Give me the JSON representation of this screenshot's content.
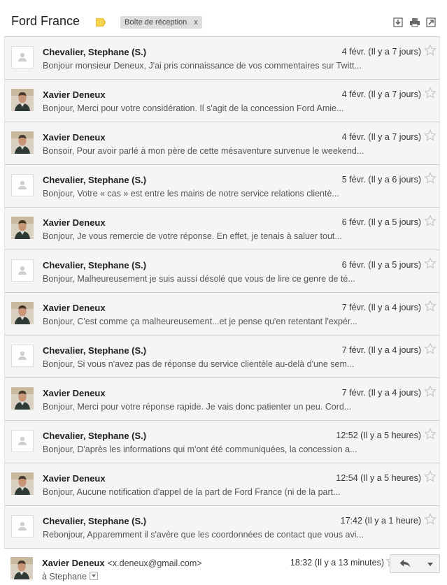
{
  "header": {
    "subject": "Ford France",
    "label": "Boîte de réception",
    "label_remove": "x",
    "icons": [
      "download-icon",
      "print-icon",
      "new-window-icon"
    ],
    "label_color": "#f7d24b"
  },
  "messages": [
    {
      "sender": "Chevalier, Stephane (S.)",
      "avatar": "placeholder",
      "date": "4 févr. (Il y a 7 jours)",
      "snippet": "Bonjour monsieur Deneux, J'ai pris connaissance de vos commentaires sur Twitt..."
    },
    {
      "sender": "Xavier Deneux",
      "avatar": "photo",
      "date": "4 févr. (Il y a 7 jours)",
      "snippet": "Bonjour, Merci pour votre considération. Il s'agit de la concession Ford Amie..."
    },
    {
      "sender": "Xavier Deneux",
      "avatar": "photo",
      "date": "4 févr. (Il y a 7 jours)",
      "snippet": "Bonsoir, Pour avoir parlé à mon père de cette mésaventure survenue le weekend..."
    },
    {
      "sender": "Chevalier, Stephane (S.)",
      "avatar": "placeholder",
      "date": "5 févr. (Il y a 6 jours)",
      "snippet": "Bonjour, Votre « cas » est entre les mains de notre service relations clientè..."
    },
    {
      "sender": "Xavier Deneux",
      "avatar": "photo",
      "date": "6 févr. (Il y a 5 jours)",
      "snippet": "Bonjour, Je vous remercie de votre réponse. En effet, je tenais à saluer tout..."
    },
    {
      "sender": "Chevalier, Stephane (S.)",
      "avatar": "placeholder",
      "date": "6 févr. (Il y a 5 jours)",
      "snippet": "Bonjour, Malheureusement je suis aussi désolé que vous de lire ce genre de té..."
    },
    {
      "sender": "Xavier Deneux",
      "avatar": "photo",
      "date": "7 févr. (Il y a 4 jours)",
      "snippet": "Bonjour, C'est comme ça malheureusement...et je pense qu'en retentant l'expér..."
    },
    {
      "sender": "Chevalier, Stephane (S.)",
      "avatar": "placeholder",
      "date": "7 févr. (Il y a 4 jours)",
      "snippet": "Bonjour, Si vous n'avez pas de réponse du service clientèle au-delà d'une sem..."
    },
    {
      "sender": "Xavier Deneux",
      "avatar": "photo",
      "date": "7 févr. (Il y a 4 jours)",
      "snippet": "Bonjour, Merci pour votre réponse rapide. Je vais donc patienter un peu. Cord..."
    },
    {
      "sender": "Chevalier, Stephane (S.)",
      "avatar": "placeholder",
      "date": "12:52 (Il y a 5 heures)",
      "snippet": "Bonjour, D'après les informations qui m'ont été communiquées, la concession a..."
    },
    {
      "sender": "Xavier Deneux",
      "avatar": "photo",
      "date": "12:54 (Il y a 5 heures)",
      "snippet": "Bonjour, Aucune notification d'appel de la part de Ford France (ni de la part..."
    },
    {
      "sender": "Chevalier, Stephane (S.)",
      "avatar": "placeholder",
      "date": "17:42 (Il y a 1 heure)",
      "snippet": "Rebonjour, Apparemment il s'avère que les coordonnées de contact que vous avi..."
    }
  ],
  "expanded_message": {
    "sender": "Xavier Deneux",
    "email": "<x.deneux@gmail.com>",
    "date": "18:32 (Il y a 13 minutes)",
    "to_line": "à Stephane",
    "avatar": "photo"
  },
  "colors": {
    "collapsed_bg": "#f5f5f5",
    "divider": "#cfcfcf",
    "star": "#c8c8c8"
  }
}
